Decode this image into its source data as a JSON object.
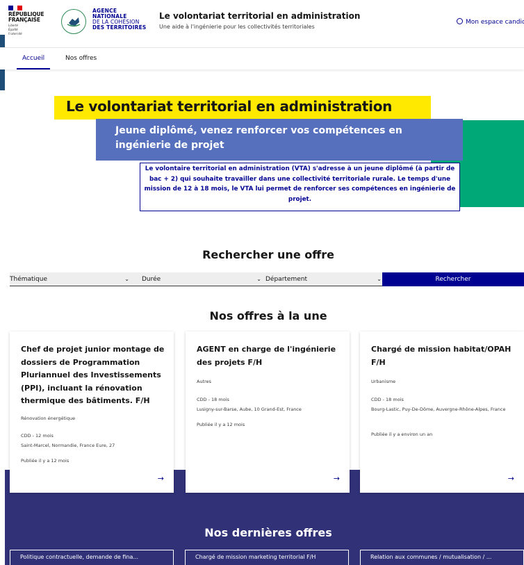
{
  "header": {
    "rf_name_line1": "RÉPUBLIQUE",
    "rf_name_line2": "FRANÇAISE",
    "rf_motto_line1": "Liberté",
    "rf_motto_line2": "Égalité",
    "rf_motto_line3": "Fraternité",
    "agency_line1": "AGENCE",
    "agency_line2": "NATIONALE",
    "agency_line3": "DE LA COHÉSION",
    "agency_line4": "DES TERRITOIRES",
    "site_title": "Le volontariat territorial en administration",
    "site_tagline": "Une aide à l'ingénierie pour les collectivités territoriales",
    "account_label": "Mon espace candida"
  },
  "nav": {
    "home": "Accueil",
    "offers": "Nos offres"
  },
  "hero": {
    "title": "Le volontariat territorial en administration",
    "subtitle": "Jeune diplômé, venez renforcer vos compétences en ingénierie de projet",
    "description": "Le volontaire territorial en administration (VTA) s'adresse à un jeune diplômé (à partir de bac + 2) qui souhaite travailler dans une collectivité territoriale rurale. Le temps d'une mission de 12 à 18 mois, le VTA lui permet de renforcer ses compétences en ingénierie de projet."
  },
  "search": {
    "title": "Rechercher une offre",
    "theme_label": "Thématique",
    "duration_label": "Durée",
    "department_label": "Département",
    "button": "Rechercher"
  },
  "featured": {
    "title": "Nos offres à la une",
    "cards": [
      {
        "title": "Chef de projet junior montage de dossiers de Programmation Pluriannuel des Investissements (PPI), incluant la rénovation thermique des bâtiments. F/H",
        "category": "Rénovation énergétique",
        "contract": "CDD - 12 mois",
        "location": "Saint-Marcel, Normandie, France Eure, 27",
        "published": "Publiée il y a 12 mois"
      },
      {
        "title": "AGENT en charge de l'ingénierie des projets F/H",
        "category": "Autres",
        "contract": "CDD - 18 mois",
        "location": "Lusigny-sur-Barse, Aube, 10 Grand-Est, France",
        "published": "Publiée il y a 12 mois"
      },
      {
        "title": "Chargé de mission habitat/OPAH F/H",
        "category": "Urbanisme",
        "contract": "CDD - 18 mois",
        "location": "Bourg-Lastic, Puy-De-Dôme, Auvergne-Rhône-Alpes, France",
        "published": "Publiée il y a environ un an"
      }
    ]
  },
  "latest": {
    "title": "Nos dernières offres",
    "items": [
      "Politique contractuelle, demande de fina...",
      "Chargé de mission marketing territorial F/H",
      "Relation aux communes / mutualisation / ..."
    ]
  },
  "colors": {
    "primary_blue": "#000091",
    "hero_yellow": "#ffe900",
    "hero_purple": "#5770be",
    "hero_green": "#00a878",
    "band": "#313178"
  },
  "icons": [
    "user-icon",
    "chevron-down-icon",
    "arrow-right-icon"
  ]
}
